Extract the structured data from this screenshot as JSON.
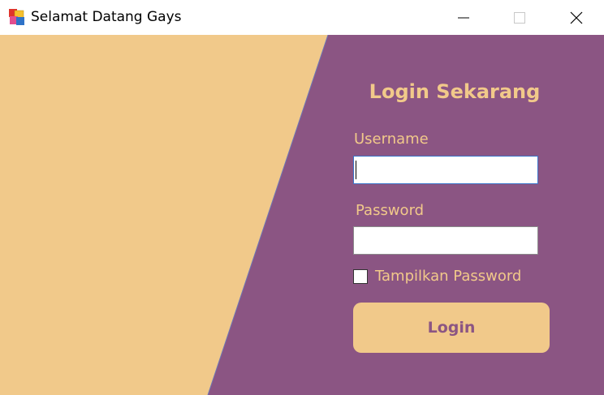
{
  "window": {
    "title": "Selamat Datang Gays",
    "icon": "windows-forms-app-icon",
    "controls": [
      "minimize-icon",
      "maximize-icon",
      "close-icon"
    ]
  },
  "form": {
    "title": "Login Sekarang",
    "username_label": "Username",
    "username_value": "",
    "password_label": "Password",
    "password_value": "",
    "show_password_label": "Tampilkan Password",
    "show_password_checked": false,
    "login_button": "Login"
  },
  "colors": {
    "accent_left": "#F1C98A",
    "accent_right": "#8B5583",
    "text": "#F1C98A"
  }
}
